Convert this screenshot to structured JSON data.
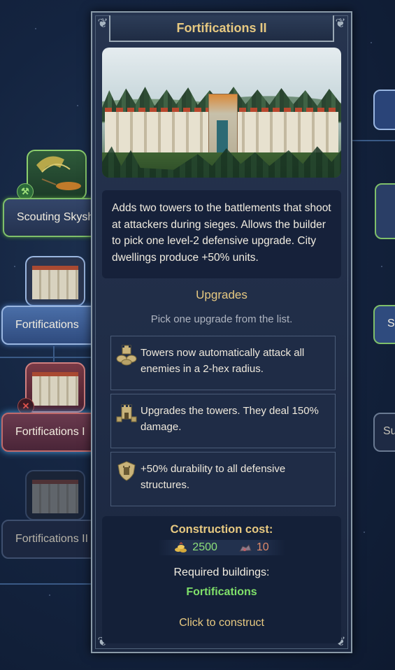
{
  "tooltip": {
    "title": "Fortifications II",
    "description": "Adds two towers to the battlements that shoot at attackers during sieges. Allows the builder to pick one level-2 defensive upgrade. City dwellings produce +50% units.",
    "upgrades_heading": "Upgrades",
    "upgrades_hint": "Pick one upgrade from the list.",
    "upgrades": [
      {
        "icon": "tower-stack-icon",
        "text": "Towers now automatically attack all enemies in a 2-hex radius."
      },
      {
        "icon": "tower-coins-icon",
        "text": "Upgrades the towers. They deal 150% damage."
      },
      {
        "icon": "shield-icon",
        "text": "+50% durability to all defensive structures."
      }
    ],
    "cost_heading": "Construction cost:",
    "costs": [
      {
        "icon": "gold-icon",
        "value": "2500",
        "color": "#8de07a"
      },
      {
        "icon": "ore-icon",
        "value": "10",
        "color": "#e08a6a"
      }
    ],
    "required_heading": "Required buildings:",
    "required_building": "Fortifications",
    "action": "Click to construct"
  },
  "tree": {
    "nodes": [
      {
        "label": "Scouting Skyshi",
        "state": "built"
      },
      {
        "label": "Fortifications",
        "state": "built"
      },
      {
        "label": "Fortifications I",
        "state": "selected"
      },
      {
        "label": "Fortifications II",
        "state": "locked"
      }
    ],
    "right_labels": [
      "S",
      "Su"
    ]
  },
  "colors": {
    "accent_gold": "#e7c981",
    "positive_green": "#7fe06a",
    "panel_bg": "#1b2740"
  }
}
